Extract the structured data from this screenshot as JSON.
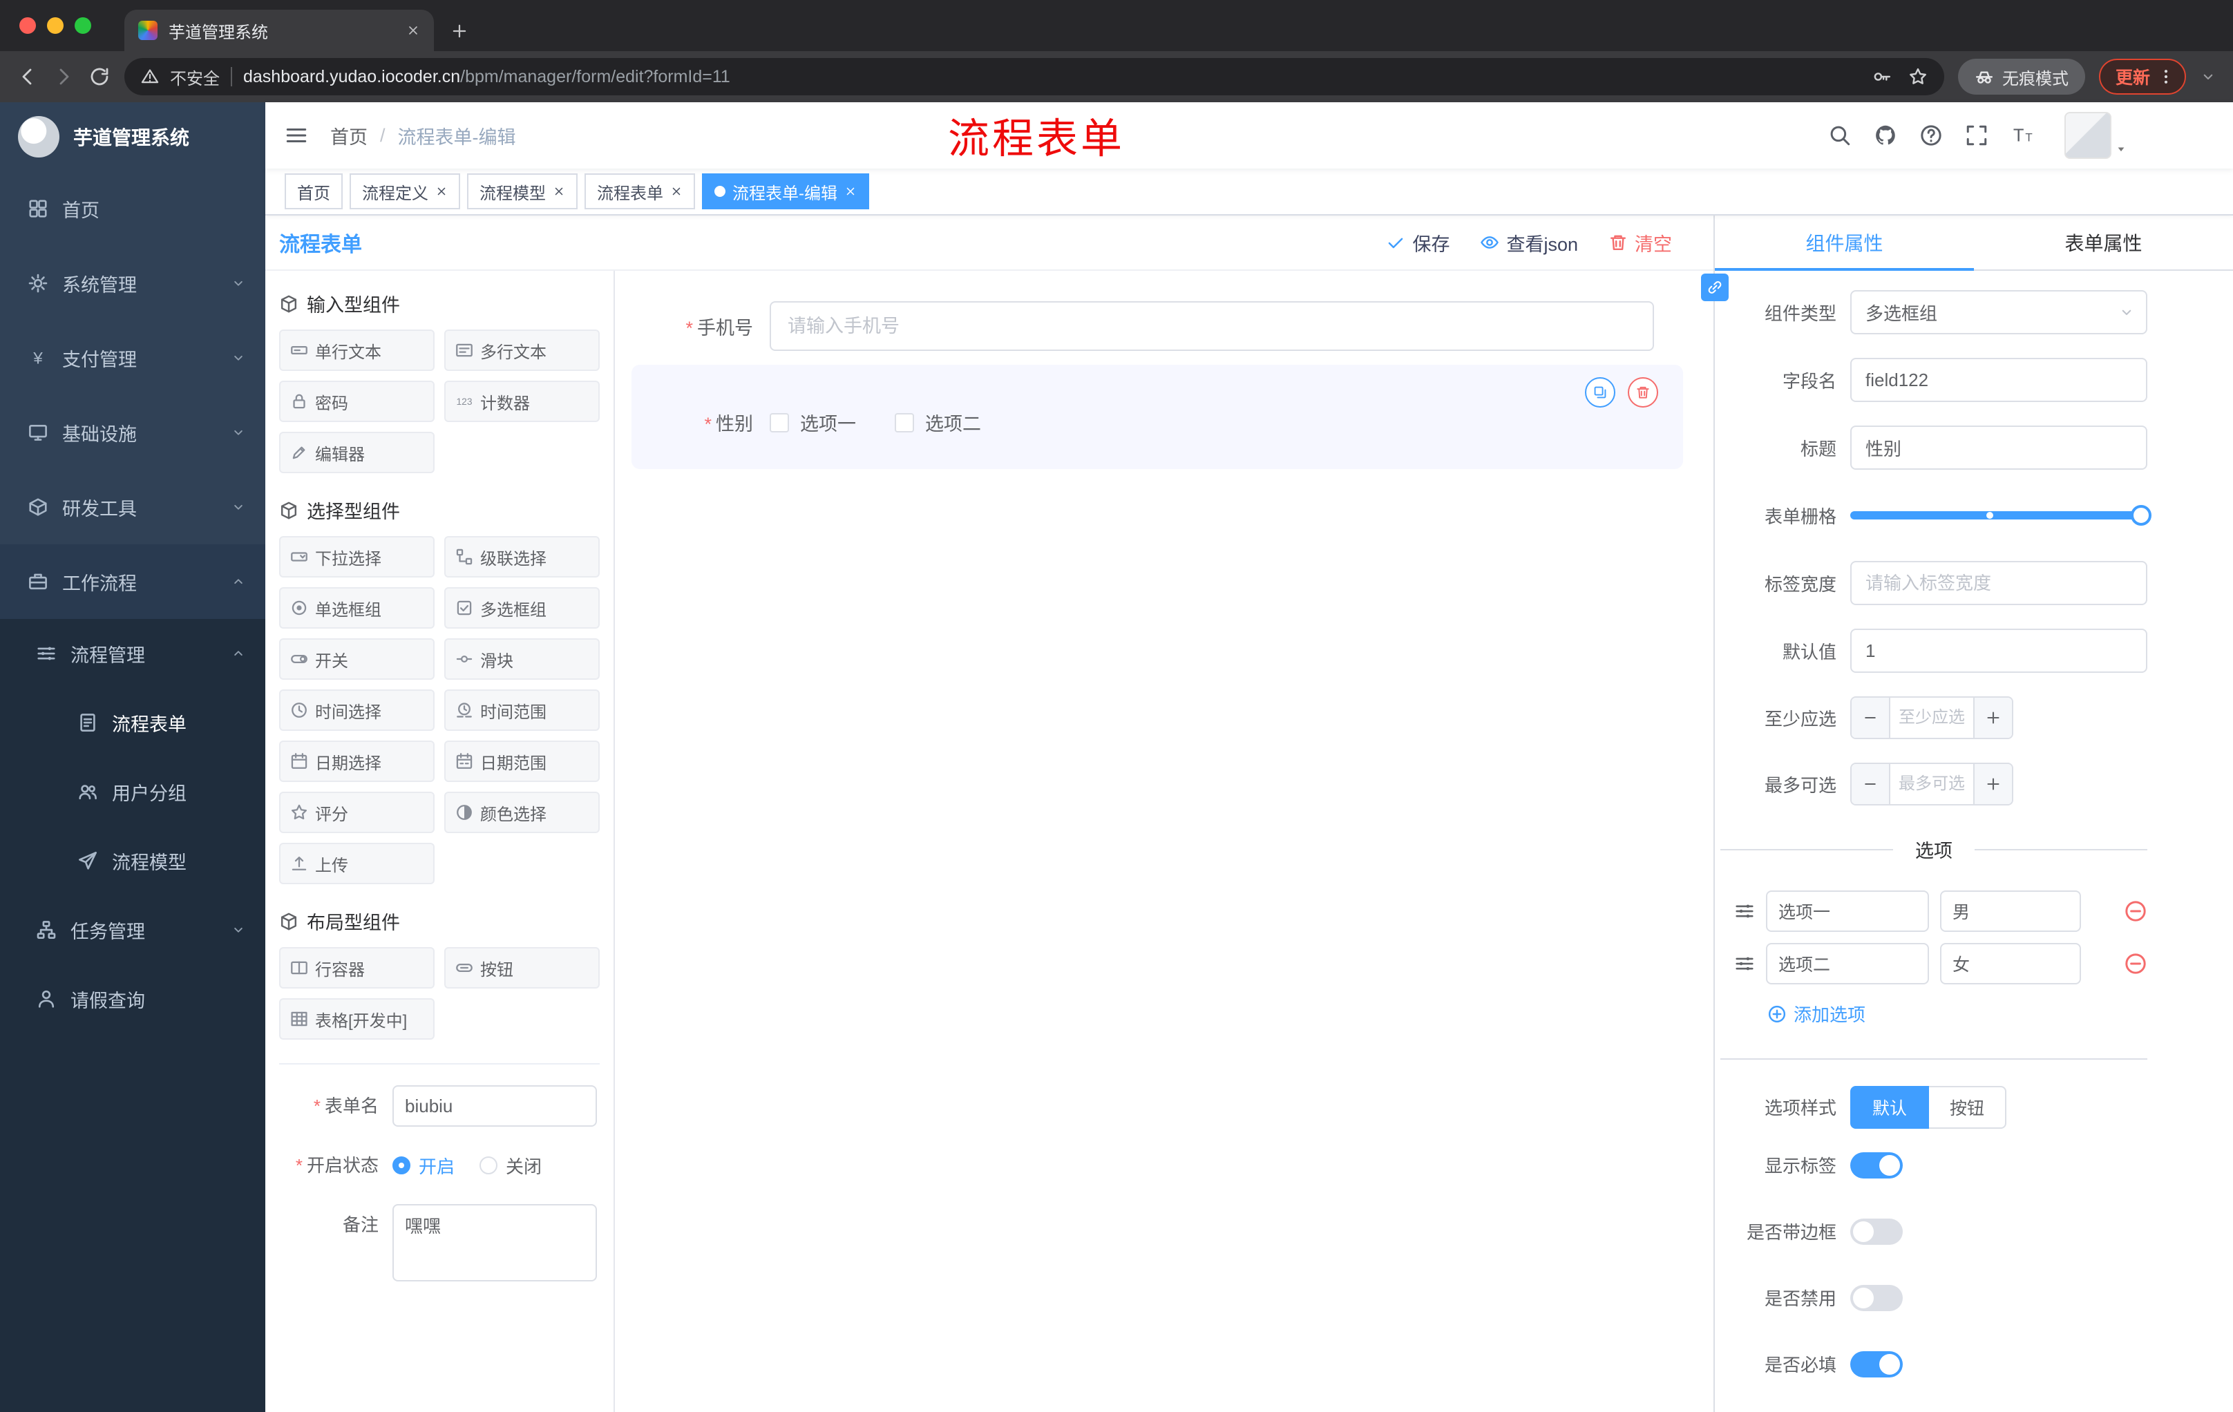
{
  "colors": {
    "primary": "#409eff",
    "danger": "#f56c6c",
    "sidebar_bg": "#304156",
    "sidebar_sub_bg": "#1f2d3d",
    "selected_widget_bg": "#f6f7ff",
    "annotation_red": "#ee0b0b"
  },
  "browser": {
    "tab_title": "芋道管理系统",
    "security_label": "不安全",
    "url_domain": "dashboard.yudao.iocoder.cn",
    "url_path": "/bpm/manager/form/edit?formId=11",
    "incognito_label": "无痕模式",
    "update_label": "更新"
  },
  "sidebar": {
    "logo_title": "芋道管理系统",
    "items": [
      {
        "label": "首页",
        "icon": "dashboard-icon"
      },
      {
        "label": "系统管理",
        "icon": "gear-icon"
      },
      {
        "label": "支付管理",
        "icon": "payment-icon"
      },
      {
        "label": "基础设施",
        "icon": "infra-icon"
      },
      {
        "label": "研发工具",
        "icon": "devtools-icon"
      },
      {
        "label": "工作流程",
        "icon": "workflow-icon"
      },
      {
        "label": "流程管理",
        "icon": "process-icon"
      },
      {
        "label": "流程表单",
        "icon": "form-icon",
        "active": true
      },
      {
        "label": "用户分组",
        "icon": "user-group-icon"
      },
      {
        "label": "流程模型",
        "icon": "model-icon"
      },
      {
        "label": "任务管理",
        "icon": "task-icon"
      },
      {
        "label": "请假查询",
        "icon": "leave-icon"
      }
    ]
  },
  "header": {
    "breadcrumb_home": "首页",
    "breadcrumb_current": "流程表单-编辑",
    "annotation": "流程表单"
  },
  "tags": [
    {
      "label": "首页"
    },
    {
      "label": "流程定义"
    },
    {
      "label": "流程模型"
    },
    {
      "label": "流程表单"
    },
    {
      "label": "流程表单-编辑",
      "active": true
    }
  ],
  "designer": {
    "title": "流程表单",
    "save_label": "保存",
    "view_json_label": "查看json",
    "clear_label": "清空",
    "groups": [
      {
        "title": "输入型组件",
        "items": [
          {
            "label": "单行文本",
            "icon": "input-icon"
          },
          {
            "label": "多行文本",
            "icon": "textarea-icon"
          },
          {
            "label": "密码",
            "icon": "password-icon"
          },
          {
            "label": "计数器",
            "icon": "counter-icon"
          },
          {
            "label": "编辑器",
            "icon": "editor-icon"
          }
        ]
      },
      {
        "title": "选择型组件",
        "items": [
          {
            "label": "下拉选择",
            "icon": "select-icon"
          },
          {
            "label": "级联选择",
            "icon": "cascader-icon"
          },
          {
            "label": "单选框组",
            "icon": "radio-icon"
          },
          {
            "label": "多选框组",
            "icon": "checkbox-icon"
          },
          {
            "label": "开关",
            "icon": "switch-icon"
          },
          {
            "label": "滑块",
            "icon": "slider-icon"
          },
          {
            "label": "时间选择",
            "icon": "time-icon"
          },
          {
            "label": "时间范围",
            "icon": "time-range-icon"
          },
          {
            "label": "日期选择",
            "icon": "date-icon"
          },
          {
            "label": "日期范围",
            "icon": "date-range-icon"
          },
          {
            "label": "评分",
            "icon": "rate-icon"
          },
          {
            "label": "颜色选择",
            "icon": "color-icon"
          },
          {
            "label": "上传",
            "icon": "upload-icon"
          }
        ]
      },
      {
        "title": "布局型组件",
        "items": [
          {
            "label": "行容器",
            "icon": "row-icon"
          },
          {
            "label": "按钮",
            "icon": "button-icon"
          },
          {
            "label": "表格[开发中]",
            "icon": "table-icon"
          }
        ]
      }
    ],
    "meta": {
      "name_label": "表单名",
      "name_value": "biubiu",
      "status_label": "开启状态",
      "status_on": "开启",
      "status_off": "关闭",
      "remark_label": "备注",
      "remark_value": "嘿嘿"
    },
    "canvas": {
      "phone_label": "手机号",
      "phone_placeholder": "请输入手机号",
      "gender_label": "性别",
      "gender_option1": "选项一",
      "gender_option2": "选项二"
    }
  },
  "props": {
    "tab_component": "组件属性",
    "tab_form": "表单属性",
    "component_type_label": "组件类型",
    "component_type_value": "多选框组",
    "field_name_label": "字段名",
    "field_name_value": "field122",
    "title_label": "标题",
    "title_value": "性别",
    "grid_label": "表单栅格",
    "label_width_label": "标签宽度",
    "label_width_placeholder": "请输入标签宽度",
    "default_label": "默认值",
    "default_value": "1",
    "min_label": "至少应选",
    "min_placeholder": "至少应选",
    "max_label": "最多可选",
    "max_placeholder": "最多可选",
    "options_divider": "选项",
    "option_rows": [
      {
        "name": "选项一",
        "value": "男"
      },
      {
        "name": "选项二",
        "value": "女"
      }
    ],
    "add_option_label": "添加选项",
    "style_label": "选项样式",
    "style_default": "默认",
    "style_button": "按钮",
    "toggles": [
      {
        "label": "显示标签",
        "on": true
      },
      {
        "label": "是否带边框",
        "on": false
      },
      {
        "label": "是否禁用",
        "on": false
      },
      {
        "label": "是否必填",
        "on": true
      }
    ]
  }
}
